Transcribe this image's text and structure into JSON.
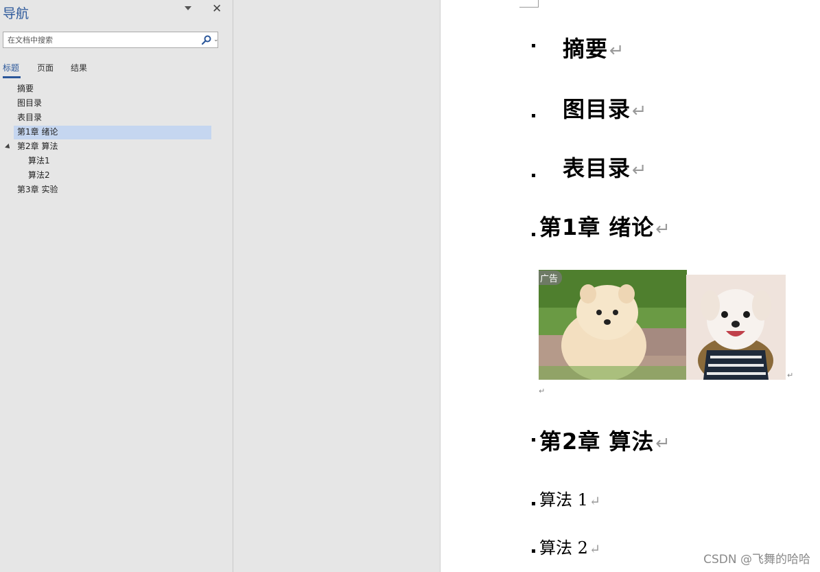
{
  "nav": {
    "title": "导航",
    "search_placeholder": "在文档中搜索",
    "tabs": [
      {
        "label": "标题",
        "active": true
      },
      {
        "label": "页面",
        "active": false
      },
      {
        "label": "结果",
        "active": false
      }
    ],
    "tree": [
      {
        "label": "摘要",
        "level": 1
      },
      {
        "label": "图目录",
        "level": 1
      },
      {
        "label": "表目录",
        "level": 1
      },
      {
        "label": "第1章 绪论",
        "level": 1,
        "selected": true
      },
      {
        "label": "第2章 算法",
        "level": 1,
        "expanded": true
      },
      {
        "label": "算法1",
        "level": 2
      },
      {
        "label": "算法2",
        "level": 2
      },
      {
        "label": "第3章 实验",
        "level": 1
      }
    ]
  },
  "document": {
    "headings": [
      {
        "text": "摘要",
        "style": "heading1"
      },
      {
        "text": "图目录",
        "style": "heading1"
      },
      {
        "text": "表目录",
        "style": "heading1"
      },
      {
        "text": "第1章 绪论",
        "style": "heading1"
      },
      {
        "text": "第2章 算法",
        "style": "heading1"
      },
      {
        "text": "算法 1",
        "style": "heading2"
      },
      {
        "text": "算法 2",
        "style": "heading2"
      }
    ],
    "paragraph_mark": "↵",
    "ad_badge": "广告"
  },
  "watermark": "CSDN @飞舞的哈哈",
  "colors": {
    "accent": "#2b579a",
    "selected_bg": "#c5d6f0",
    "pane_bg": "#e6e6e6"
  }
}
